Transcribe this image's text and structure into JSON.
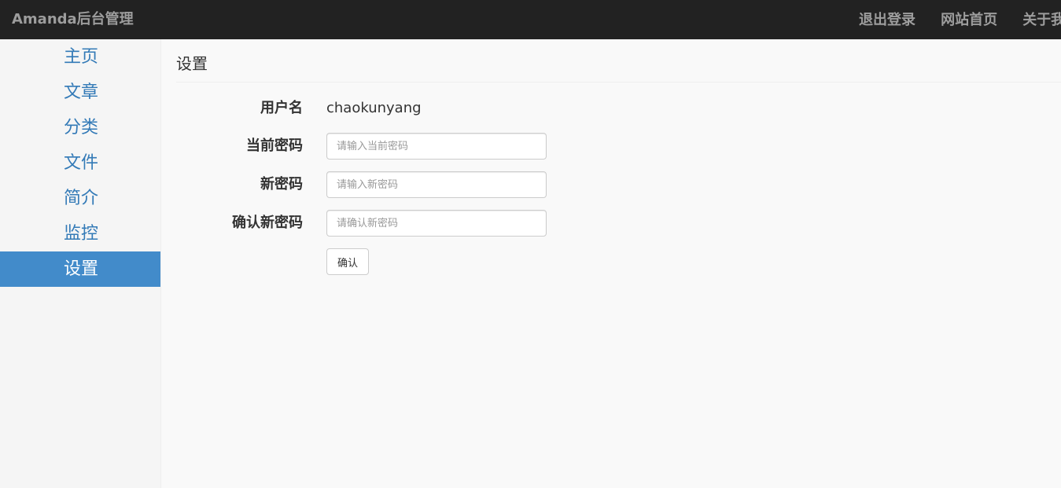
{
  "header": {
    "brand": "Amanda后台管理",
    "nav": [
      "退出登录",
      "网站首页",
      "关于我"
    ]
  },
  "sidebar": {
    "items": [
      {
        "label": "主页",
        "active": false
      },
      {
        "label": "文章",
        "active": false
      },
      {
        "label": "分类",
        "active": false
      },
      {
        "label": "文件",
        "active": false
      },
      {
        "label": "简介",
        "active": false
      },
      {
        "label": "监控",
        "active": false
      },
      {
        "label": "设置",
        "active": true
      }
    ]
  },
  "main": {
    "title": "设置",
    "form": {
      "username_label": "用户名",
      "username_value": "chaokunyang",
      "current_password_label": "当前密码",
      "current_password_placeholder": "请输入当前密码",
      "new_password_label": "新密码",
      "new_password_placeholder": "请输入新密码",
      "confirm_password_label": "确认新密码",
      "confirm_password_placeholder": "请确认新密码",
      "submit_label": "确认"
    }
  },
  "colors": {
    "navbar_bg": "#222222",
    "navbar_text": "#9d9d9d",
    "link": "#337ab7",
    "active_bg": "#428bca"
  }
}
